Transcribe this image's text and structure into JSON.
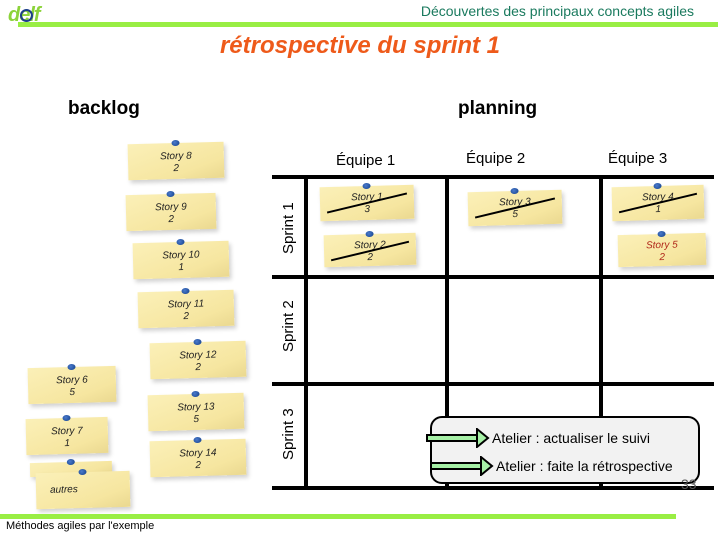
{
  "header": {
    "logo_text": "delf",
    "subtitle": "Découvertes des principaux concepts agiles",
    "accent_color": "#99ee44"
  },
  "title": "rétrospective du sprint 1",
  "sections": {
    "backlog": "backlog",
    "planning": "planning"
  },
  "backlog": {
    "stories": [
      {
        "name": "Story 8",
        "points": "2"
      },
      {
        "name": "Story 9",
        "points": "2"
      },
      {
        "name": "Story 10",
        "points": "1"
      },
      {
        "name": "Story 11",
        "points": "2"
      },
      {
        "name": "Story 12",
        "points": "2"
      },
      {
        "name": "Story 6",
        "points": "5"
      },
      {
        "name": "Story 13",
        "points": "5"
      },
      {
        "name": "Story 7",
        "points": "1"
      },
      {
        "name": "Story 14",
        "points": "2"
      }
    ],
    "others_label": "autres"
  },
  "planning": {
    "teams": [
      "Équipe 1",
      "Équipe 2",
      "Équipe 3"
    ],
    "sprints": [
      "Sprint 1",
      "Sprint 2",
      "Sprint 3"
    ],
    "cards": [
      {
        "name": "Story 1",
        "points": "3",
        "team": "Équipe 1",
        "sprint": "Sprint 1",
        "done": true
      },
      {
        "name": "Story 2",
        "points": "2",
        "team": "Équipe 1",
        "sprint": "Sprint 1",
        "done": true
      },
      {
        "name": "Story 3",
        "points": "5",
        "team": "Équipe 2",
        "sprint": "Sprint 1",
        "done": true
      },
      {
        "name": "Story 4",
        "points": "1",
        "team": "Équipe 3",
        "sprint": "Sprint 1",
        "done": true
      },
      {
        "name": "Story 5",
        "points": "2",
        "team": "Équipe 3",
        "sprint": "Sprint 1",
        "done": false,
        "color": "#b0281a"
      }
    ]
  },
  "callout": {
    "items": [
      "Atelier : actualiser le suivi",
      "Atelier : faite la rétrospective"
    ]
  },
  "footer": {
    "text": "Méthodes agiles par l'exemple",
    "page_number": "33"
  }
}
